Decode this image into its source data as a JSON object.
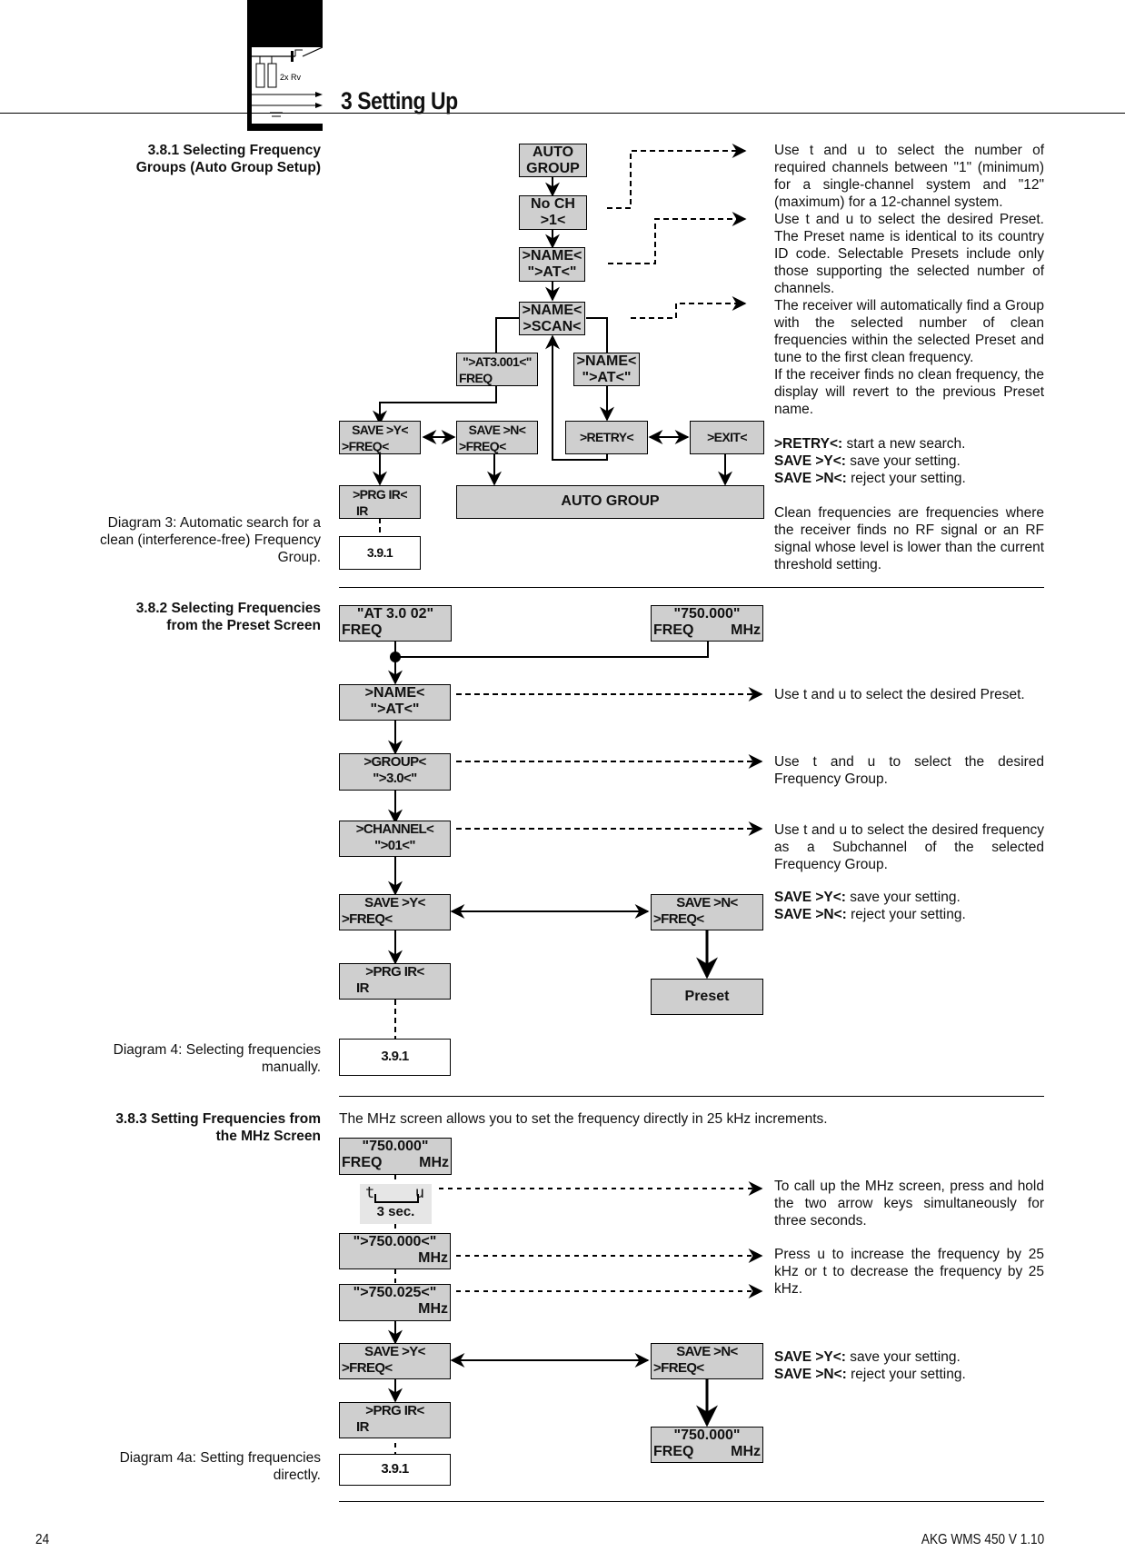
{
  "header": {
    "chapter_title": "3 Setting Up",
    "logo_label": "2x Rv"
  },
  "sections": [
    {
      "heading": "3.8.1 Selecting Frequency Groups (Auto Group Setup)",
      "heading_lines": [
        "3.8.1 Selecting Frequency",
        "Groups (Auto Group Setup)"
      ],
      "caption_lines": [
        "Diagram 3: Automatic search for a",
        "clean (interference-free) Frequency",
        "Group."
      ],
      "boxes": {
        "auto_group_top": [
          "AUTO",
          "GROUP"
        ],
        "no_ch": [
          "No CH",
          ">1<"
        ],
        "name_at": [
          ">NAME<",
          "\">AT<\""
        ],
        "name_scan": [
          ">NAME<",
          ">SCAN<"
        ],
        "at3001": [
          "\">AT3.001<\"",
          "FREQ"
        ],
        "name_at_right": [
          ">NAME<",
          "\">AT<\""
        ],
        "save_y": [
          "SAVE >Y<",
          ">FREQ<"
        ],
        "save_n": [
          "SAVE >N<",
          ">FREQ<"
        ],
        "retry": ">RETRY<",
        "exit": ">EXIT<",
        "prg_ir": [
          ">PRG IR<",
          "IR"
        ],
        "auto_group_bottom": "AUTO GROUP",
        "ref": "3.9.1"
      },
      "descriptions": [
        "Use t  and u  to select the number of required channels between \"1\" (minimum) for a single-channel system and \"12\" (maximum) for a 12-channel system.",
        "Use t  and u  to select the desired Preset. The Preset name is identical to its country ID code. Selectable Presets include only those supporting the selected number of channels.",
        "The receiver will automatically find a Group with the selected number of clean frequencies within the selected Preset and tune to the first clean frequency.",
        "If the receiver finds no clean frequency, the display will revert to the previous Preset name."
      ],
      "legend": [
        {
          "key": ">RETRY<:",
          "text": " start a new search."
        },
        {
          "key": "SAVE >Y<:",
          "text": " save your setting."
        },
        {
          "key": "SAVE >N<:",
          "text": " reject your setting."
        }
      ],
      "note": "Clean frequencies are frequencies where the receiver finds no RF signal or an RF signal whose level is lower than the current threshold setting."
    },
    {
      "heading_lines": [
        "3.8.2 Selecting Frequencies",
        "from the Preset Screen"
      ],
      "caption_lines": [
        "Diagram 4: Selecting frequencies",
        "manually."
      ],
      "boxes": {
        "at_30_02": [
          "\"AT 3.0 02\"",
          "FREQ"
        ],
        "freq_750": [
          "\"750.000\"",
          "FREQ",
          "MHz"
        ],
        "name_at": [
          ">NAME<",
          "\">AT<\""
        ],
        "group": [
          ">GROUP<",
          "\">3.0<\""
        ],
        "channel": [
          ">CHANNEL<",
          "\">01<\""
        ],
        "save_y": [
          "SAVE >Y<",
          ">FREQ<"
        ],
        "save_n": [
          "SAVE >N<",
          ">FREQ<"
        ],
        "prg_ir": [
          ">PRG IR<",
          "IR"
        ],
        "preset": "Preset",
        "ref": "3.9.1"
      },
      "descriptions": [
        "Use t  and u  to select the desired Preset.",
        "Use t  and u  to select the desired Frequency Group.",
        "Use t  and u  to select the desired frequency as a Subchannel of the selected Frequency Group."
      ],
      "legend": [
        {
          "key": "SAVE >Y<:",
          "text": " save your setting."
        },
        {
          "key": "SAVE >N<:",
          "text": " reject your setting."
        }
      ]
    },
    {
      "heading_lines": [
        "3.8.3 Setting Frequencies from",
        "the MHz Screen"
      ],
      "caption_lines": [
        "Diagram 4a: Setting frequencies",
        "directly."
      ],
      "intro": "The MHz screen allows you to set the frequency directly in 25 kHz increments.",
      "boxes": {
        "freq_750": [
          "\"750.000\"",
          "FREQ",
          "MHz"
        ],
        "keys": {
          "left": "t",
          "right": "u",
          "hold": "3 sec."
        },
        "f750000": [
          "\">750.000<\"",
          "MHz"
        ],
        "f750025": [
          "\">750.025<\"",
          "MHz"
        ],
        "save_y": [
          "SAVE >Y<",
          ">FREQ<"
        ],
        "save_n": [
          "SAVE >N<",
          ">FREQ<"
        ],
        "prg_ir": [
          ">PRG IR<",
          "IR"
        ],
        "result": [
          "\"750.000\"",
          "FREQ",
          "MHz"
        ],
        "ref": "3.9.1"
      },
      "descriptions": [
        "To call up the MHz screen, press and hold the two arrow keys simultaneously for three seconds.",
        "Press u  to increase the frequency by 25 kHz or t  to decrease the frequency by 25 kHz."
      ],
      "legend": [
        {
          "key": "SAVE >Y<:",
          "text": " save your setting."
        },
        {
          "key": "SAVE >N<:",
          "text": " reject your setting."
        }
      ]
    }
  ],
  "footer": {
    "page_number": "24",
    "product": "AKG WMS 450 V 1.10"
  }
}
